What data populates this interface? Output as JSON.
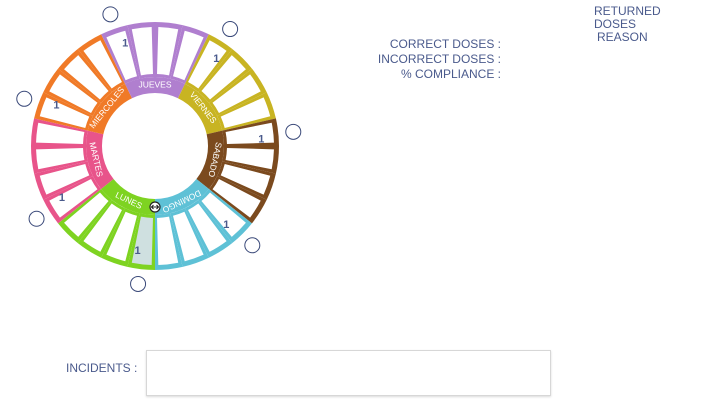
{
  "days": [
    {
      "name": "LUNES",
      "color": "#7ed321",
      "dose_count": "1"
    },
    {
      "name": "MARTES",
      "color": "#e8548a",
      "dose_count": "1"
    },
    {
      "name": "MIERCOLES",
      "color": "#f07a27",
      "dose_count": "1"
    },
    {
      "name": "JUEVES",
      "color": "#b07fcf",
      "dose_count": "1"
    },
    {
      "name": "VIERNES",
      "color": "#c8b422",
      "dose_count": "1"
    },
    {
      "name": "SABADO",
      "color": "#7b4a1e",
      "dose_count": "1"
    },
    {
      "name": "DOMINGO",
      "color": "#5ec1d6",
      "dose_count": "1"
    }
  ],
  "colors": {
    "today_slot": "#cfe0e0",
    "handle_stroke": "#3b4a7a",
    "text": "#4a5a8c"
  },
  "icons": {
    "pin": "pin-handle-icon",
    "arrow": "current-position-icon"
  },
  "stats": {
    "correct_label": "CORRECT DOSES :",
    "incorrect_label": "INCORRECT DOSES :",
    "compliance_label": "% COMPLIANCE :"
  },
  "returned": {
    "line1": "RETURNED DOSES",
    "line2": "REASON"
  },
  "incidents": {
    "label": "INCIDENTS :",
    "value": ""
  }
}
